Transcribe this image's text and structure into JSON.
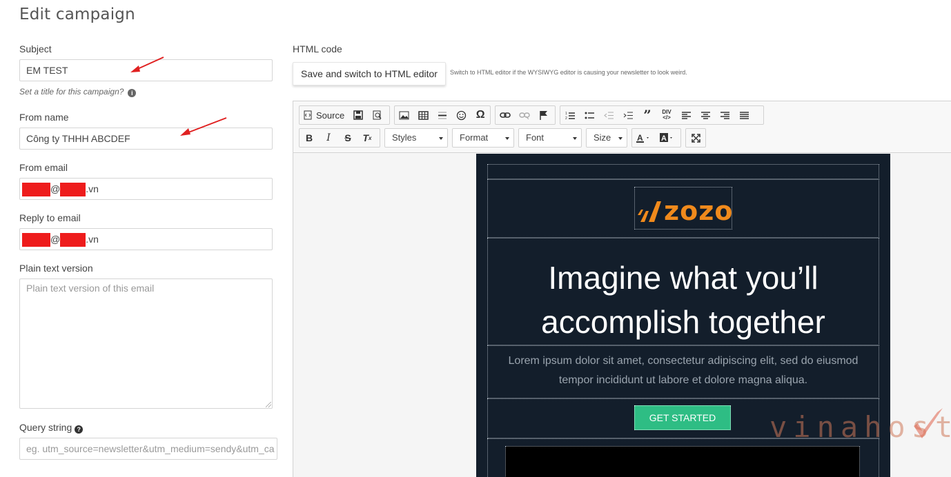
{
  "page": {
    "title": "Edit campaign"
  },
  "form": {
    "subject": {
      "label": "Subject",
      "value": "EM TEST",
      "hint": "Set a title for this campaign?"
    },
    "from_name": {
      "label": "From name",
      "value": "Công ty THHH ABCDEF"
    },
    "from_email": {
      "label": "From email",
      "value_visible_at": "@",
      "value_visible_suffix": ".vn"
    },
    "reply_to": {
      "label": "Reply to email",
      "value_visible_at": "@",
      "value_visible_suffix": ".vn"
    },
    "plain_text": {
      "label": "Plain text version",
      "placeholder": "Plain text version of this email"
    },
    "query_string": {
      "label": "Query string",
      "placeholder": "eg. utm_source=newsletter&utm_medium=sendy&utm_ca"
    }
  },
  "html_editor": {
    "label": "HTML code",
    "switch_button": "Save and switch to HTML editor",
    "switch_hint": "Switch to HTML editor if the WYSIWYG editor is causing your newsletter to look weird.",
    "toolbar": {
      "source_label": "Source",
      "styles_label": "Styles",
      "format_label": "Format",
      "font_label": "Font",
      "size_label": "Size"
    }
  },
  "email_preview": {
    "logo_text": "zozo",
    "headline_line1": "Imagine what you’ll",
    "headline_line2": "accomplish together",
    "body_line1": "Lorem ipsum dolor sit amet, consectetur adipiscing elit, sed do eiusmod",
    "body_line2": "tempor incididunt ut labore et dolore magna aliqua.",
    "cta_label": "GET STARTED"
  },
  "colors": {
    "email_bg": "#131e2b",
    "cta": "#2ebd84",
    "logo_orange": "#f08a1c",
    "redaction": "#ee1c1c",
    "annotation_arrow": "#e02020"
  },
  "watermark": {
    "text": "vinahost"
  }
}
